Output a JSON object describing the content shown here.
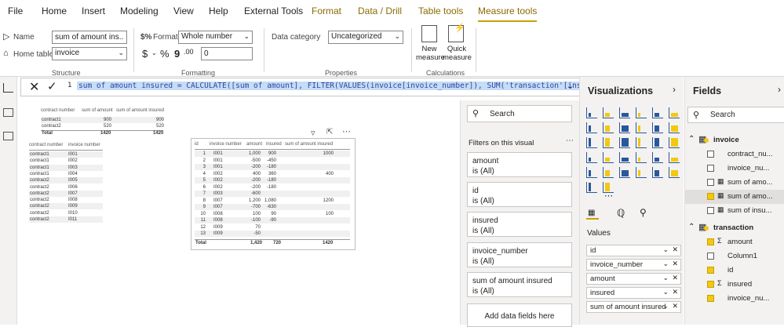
{
  "tabs": [
    "File",
    "Home",
    "Insert",
    "Modeling",
    "View",
    "Help",
    "External Tools",
    "Format",
    "Data / Drill",
    "Table tools",
    "Measure tools"
  ],
  "ribbon": {
    "name_label": "Name",
    "name_value": "sum of amount ins...",
    "home_table_label": "Home table",
    "home_table_value": "invoice",
    "format_label": "Format",
    "format_value": "Whole number",
    "currency": "$",
    "percent": "%",
    "comma": "9",
    "decimals": "0",
    "data_category_label": "Data category",
    "data_category_value": "Uncategorized",
    "new_measure": "New measure",
    "quick_measure": "Quick measure",
    "groups": [
      "Structure",
      "Formatting",
      "Properties",
      "Calculations"
    ]
  },
  "formula": {
    "line": "1",
    "text": "sum of amount insured = CALCULATE([sum of amount], FILTER(VALUES(invoice[invoice_number]), SUM('transaction'[insured]) > 0))"
  },
  "table1": {
    "headers": [
      "contract number",
      "sum of amount",
      "sum of amount insured"
    ],
    "rows": [
      [
        "contract1",
        "900",
        "900"
      ],
      [
        "contract2",
        "520",
        "520"
      ]
    ],
    "total": [
      "Total",
      "1420",
      "1420"
    ]
  },
  "table2": {
    "headers": [
      "contract number",
      "invoice number"
    ],
    "rows": [
      [
        "contract1",
        "I001"
      ],
      [
        "contract1",
        "I002"
      ],
      [
        "contract1",
        "I003"
      ],
      [
        "contract1",
        "I004"
      ],
      [
        "contract2",
        "I005"
      ],
      [
        "contract2",
        "I006"
      ],
      [
        "contract2",
        "I007"
      ],
      [
        "contract2",
        "I008"
      ],
      [
        "contract2",
        "I009"
      ],
      [
        "contract2",
        "I010"
      ],
      [
        "contract2",
        "I011"
      ]
    ]
  },
  "table3": {
    "headers": [
      "id",
      "invoice number",
      "amount",
      "insured",
      "sum of amount insured"
    ],
    "rows": [
      [
        "1",
        "I001",
        "1,000",
        "900",
        "1000"
      ],
      [
        "2",
        "I001",
        "-500",
        "-450",
        ""
      ],
      [
        "3",
        "I001",
        "-200",
        "-180",
        ""
      ],
      [
        "4",
        "I002",
        "400",
        "360",
        "400"
      ],
      [
        "5",
        "I002",
        "-200",
        "-180",
        ""
      ],
      [
        "6",
        "I002",
        "-200",
        "-180",
        ""
      ],
      [
        "7",
        "I003",
        "-600",
        "",
        ""
      ],
      [
        "8",
        "I007",
        "1,200",
        "1,080",
        "1200"
      ],
      [
        "9",
        "I007",
        "-700",
        "-630",
        ""
      ],
      [
        "10",
        "I008",
        "100",
        "90",
        "100"
      ],
      [
        "11",
        "I008",
        "-100",
        "-90",
        ""
      ],
      [
        "12",
        "I009",
        "70",
        "",
        ""
      ],
      [
        "13",
        "I009",
        "-50",
        "",
        ""
      ]
    ],
    "total": [
      "Total",
      "",
      "1,420",
      "720",
      "1420"
    ]
  },
  "filters": {
    "search_placeholder": "Search",
    "section_title": "Filters on this visual",
    "cards": [
      {
        "name": "amount",
        "state": "is (All)"
      },
      {
        "name": "id",
        "state": "is (All)"
      },
      {
        "name": "insured",
        "state": "is (All)"
      },
      {
        "name": "invoice_number",
        "state": "is (All)"
      },
      {
        "name": "sum of amount insured",
        "state": "is (All)"
      }
    ],
    "add_fields": "Add data fields here"
  },
  "viz": {
    "title": "Visualizations",
    "values_label": "Values",
    "wells": [
      "id",
      "invoice_number",
      "amount",
      "insured",
      "sum of amount insured"
    ]
  },
  "fields": {
    "title": "Fields",
    "search_placeholder": "Search",
    "tables": [
      {
        "name": "invoice",
        "items": [
          {
            "label": "contract_nu...",
            "checked": false,
            "kind": ""
          },
          {
            "label": "invoice_nu...",
            "checked": false,
            "kind": ""
          },
          {
            "label": "sum of amo...",
            "checked": false,
            "kind": "measure"
          },
          {
            "label": "sum of amo...",
            "checked": true,
            "kind": "measure"
          },
          {
            "label": "sum of insu...",
            "checked": false,
            "kind": "measure"
          }
        ]
      },
      {
        "name": "transaction",
        "items": [
          {
            "label": "amount",
            "checked": true,
            "kind": "sigma"
          },
          {
            "label": "Column1",
            "checked": false,
            "kind": ""
          },
          {
            "label": "id",
            "checked": true,
            "kind": ""
          },
          {
            "label": "insured",
            "checked": true,
            "kind": "sigma"
          },
          {
            "label": "invoice_nu...",
            "checked": true,
            "kind": ""
          }
        ]
      }
    ]
  },
  "colors": {
    "accent": "#f2c811",
    "selection": "#c7dcf5",
    "pane": "#f3f2f1"
  }
}
